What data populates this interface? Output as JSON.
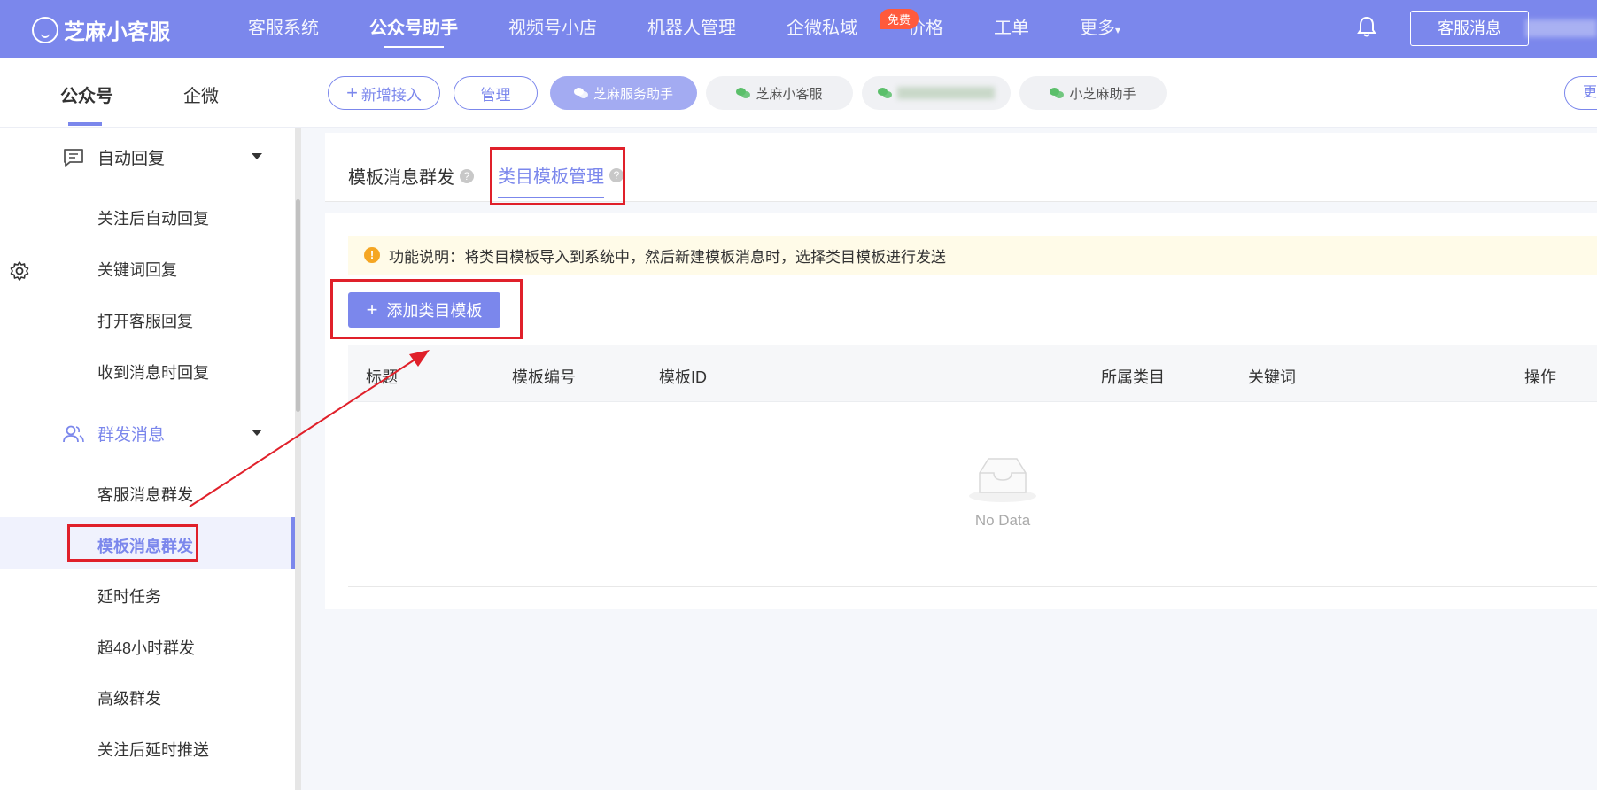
{
  "brand": {
    "name": "芝麻小客服"
  },
  "topnav": {
    "items": [
      "客服系统",
      "公众号助手",
      "视频号小店",
      "机器人管理",
      "企微私域",
      "价格",
      "工单",
      "更多"
    ],
    "badge": "免费",
    "service_button": "客服消息"
  },
  "subheader": {
    "account_tabs": [
      "公众号",
      "企微"
    ],
    "new_access": "新增接入",
    "manage": "管理",
    "accounts": [
      "芝麻服务助手",
      "芝麻小客服",
      "小芝麻助手"
    ],
    "more": "更"
  },
  "sidebar": {
    "group_auto_reply": "自动回复",
    "auto_reply_items": [
      "关注后自动回复",
      "关键词回复",
      "打开客服回复",
      "收到消息时回复"
    ],
    "group_broadcast": "群发消息",
    "broadcast_items": [
      "客服消息群发",
      "模板消息群发",
      "延时任务",
      "超48小时群发",
      "高级群发",
      "关注后延时推送"
    ]
  },
  "main": {
    "tabs": [
      "模板消息群发",
      "类目模板管理"
    ],
    "notice": "功能说明：将类目模板导入到系统中，然后新建模板消息时，选择类目模板进行发送",
    "add_button": "添加类目模板",
    "columns": [
      "标题",
      "模板编号",
      "模板ID",
      "所属类目",
      "关键词",
      "操作"
    ],
    "empty_text": "No Data"
  },
  "colors": {
    "accent": "#7b87ec",
    "annotation": "#e0202a",
    "badge": "#ff5a3c"
  }
}
